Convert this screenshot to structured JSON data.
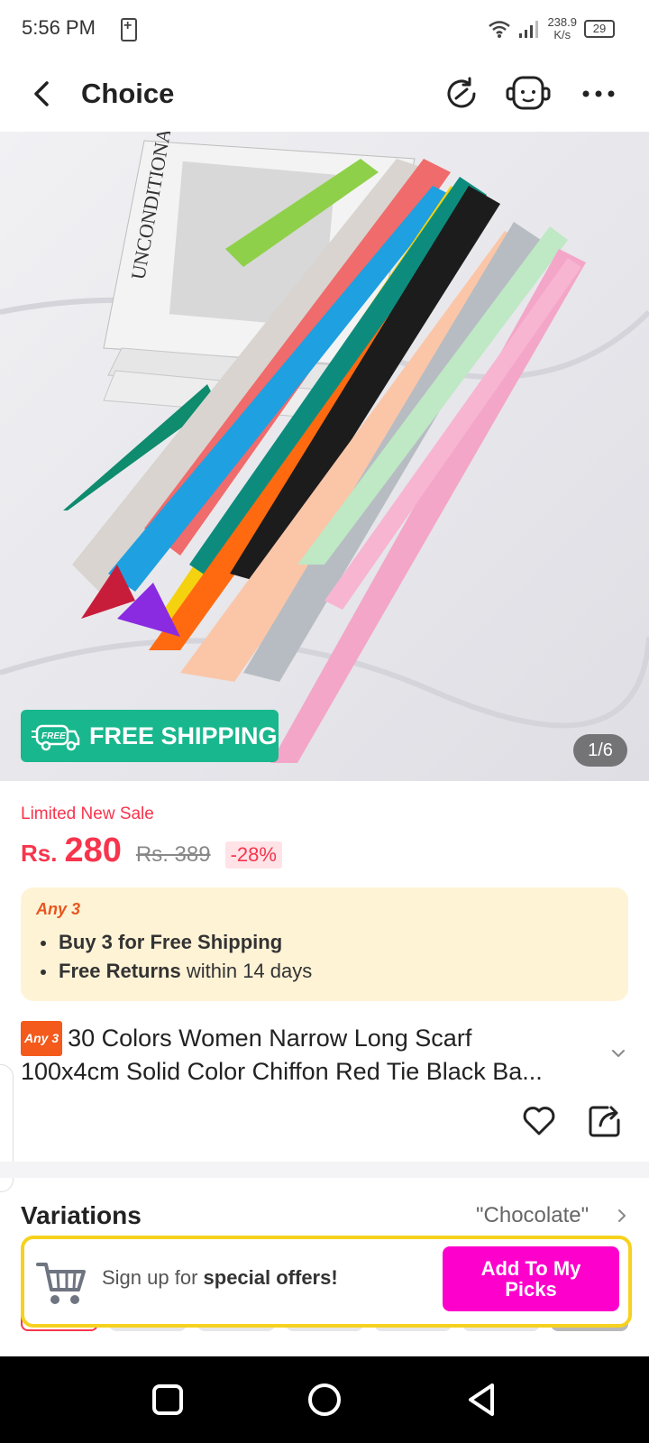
{
  "status_bar": {
    "time": "5:56 PM",
    "speed_value": "238.9",
    "speed_unit": "K/s",
    "battery": "29"
  },
  "header": {
    "title": "Choice",
    "icons": [
      "back-arrow-icon",
      "refresh-icon",
      "customer-service-icon",
      "more-icon"
    ]
  },
  "hero": {
    "free_shipping_label": "FREE SHIPPING",
    "free_tag": "FREE",
    "counter": "1/6",
    "magazine_text": "UNCONDITIONA"
  },
  "price": {
    "sale_label": "Limited New Sale",
    "currency": "Rs.",
    "current": "280",
    "original": "Rs. 389",
    "discount": "-28%"
  },
  "promo": {
    "tag": "Any 3",
    "line1_bold": "Buy 3 for  Free Shipping",
    "line2_bold": "Free Returns",
    "line2_rest": " within 14 days"
  },
  "product": {
    "badge": "Any 3",
    "title_line1": "30 Colors Women Narrow Long Scarf",
    "title_line2": "100x4cm Solid Color Chiffon Red Tie Black Ba..."
  },
  "variations": {
    "label": "Variations",
    "selected": "\"Chocolate\""
  },
  "signup": {
    "text_prefix": "Sign up for ",
    "text_bold": "special offers!",
    "button_line1": "Add To My",
    "button_line2": "Picks"
  },
  "colors": {
    "accent_red": "#f7354d",
    "teal": "#19b78d",
    "magenta": "#fd00cc",
    "yellow_border": "#f6d21e",
    "promo_bg": "#fff3d6"
  }
}
